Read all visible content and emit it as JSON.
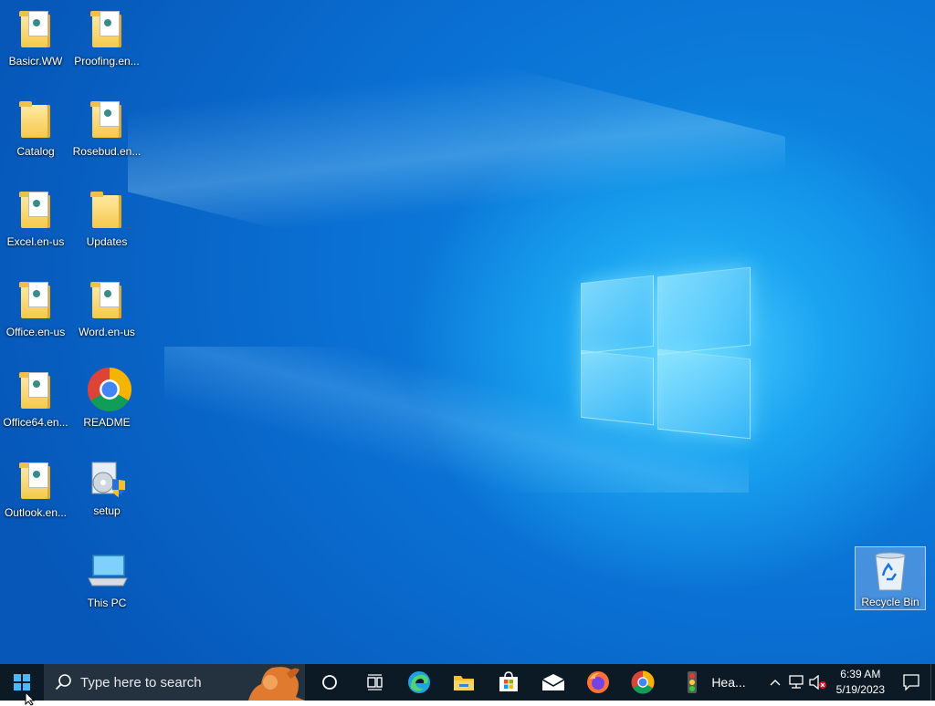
{
  "desktop": {
    "icons": [
      {
        "label": "Basicr.WW",
        "type": "folder-doc"
      },
      {
        "label": "Proofing.en...",
        "type": "folder-doc"
      },
      {
        "label": "Catalog",
        "type": "folder"
      },
      {
        "label": "Rosebud.en...",
        "type": "folder-doc"
      },
      {
        "label": "Excel.en-us",
        "type": "folder-doc"
      },
      {
        "label": "Updates",
        "type": "folder"
      },
      {
        "label": "Office.en-us",
        "type": "folder-doc"
      },
      {
        "label": "Word.en-us",
        "type": "folder-doc"
      },
      {
        "label": "Office64.en...",
        "type": "folder-doc"
      },
      {
        "label": "README",
        "type": "chrome"
      },
      {
        "label": "Outlook.en...",
        "type": "folder-doc"
      },
      {
        "label": "setup",
        "type": "setup"
      },
      {
        "label": "This PC",
        "type": "computer"
      },
      {
        "label": "Recycle Bin",
        "type": "recycle-bin"
      }
    ]
  },
  "taskbar": {
    "search_placeholder": "Type here to search",
    "pinned": [
      "cortana-icon",
      "task-view-icon",
      "edge-icon",
      "file-explorer-icon",
      "store-icon",
      "mail-icon",
      "firefox-icon",
      "chrome-icon"
    ],
    "weather_label": "Hea...",
    "time": "6:39 AM",
    "date": "5/19/2023"
  },
  "colors": {
    "taskbar": "#0c1a26",
    "desktop_accent": "#0a78d7"
  }
}
